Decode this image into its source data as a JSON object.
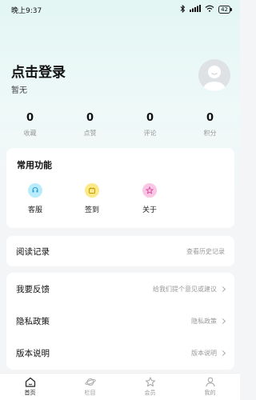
{
  "status_bar": {
    "time": "晚上9:37",
    "battery": "42"
  },
  "profile": {
    "title": "点击登录",
    "subtitle": "暂无"
  },
  "stats": [
    {
      "value": "0",
      "label": "收藏"
    },
    {
      "value": "0",
      "label": "点赞"
    },
    {
      "value": "0",
      "label": "评论"
    },
    {
      "value": "0",
      "label": "积分"
    }
  ],
  "functions": {
    "title": "常用功能",
    "items": [
      {
        "label": "客服",
        "icon": "service-icon",
        "color": "#7fd3f0"
      },
      {
        "label": "签到",
        "icon": "checkin-icon",
        "color": "#f5de57"
      },
      {
        "label": "关于",
        "icon": "about-icon",
        "color": "#f7a9d6"
      }
    ]
  },
  "reading": {
    "label": "阅读记录",
    "hint": "查看历史记录"
  },
  "menu": [
    {
      "label": "我要反馈",
      "hint": "给我们提个意见或建议"
    },
    {
      "label": "隐私政策",
      "hint": "隐私政策"
    },
    {
      "label": "版本说明",
      "hint": "版本说明"
    }
  ],
  "tabs": [
    {
      "label": "首页",
      "icon": "home-icon",
      "active": true
    },
    {
      "label": "栏目",
      "icon": "planet-icon",
      "active": false
    },
    {
      "label": "会员",
      "icon": "star-icon",
      "active": false
    },
    {
      "label": "我的",
      "icon": "user-icon",
      "active": false
    }
  ]
}
